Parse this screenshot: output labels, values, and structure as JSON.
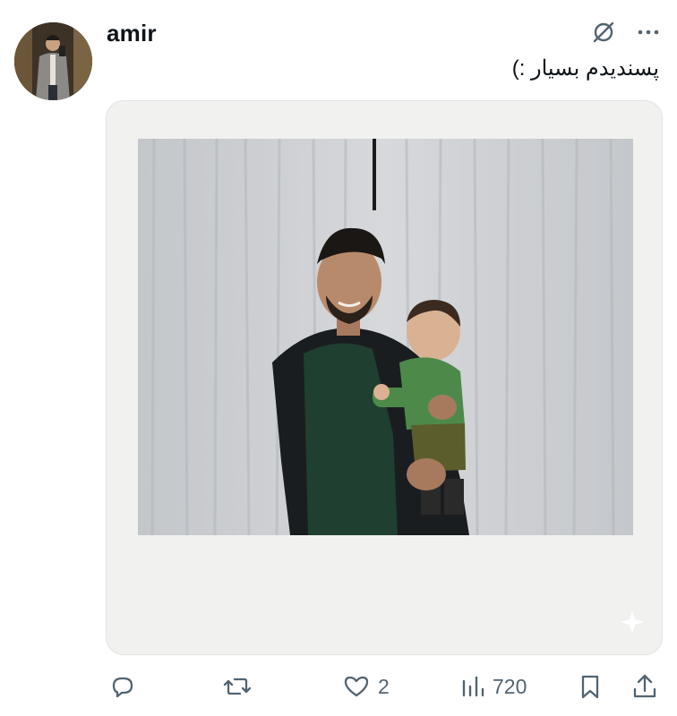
{
  "post": {
    "username": "amir",
    "text": "پسندیدم بسیار :)"
  },
  "icons": {
    "avatar": "profile-photo",
    "grok": "grok-icon",
    "more": "more-icon",
    "reply": "reply-icon",
    "repost": "repost-icon",
    "like": "heart-icon",
    "views": "views-icon",
    "bookmark": "bookmark-icon",
    "share": "share-icon",
    "sparkle": "sparkle-icon"
  },
  "actions": {
    "likes": "2",
    "views": "720"
  },
  "colors": {
    "text": "#0f1419",
    "muted": "#536471",
    "frame": "#f1f1ef"
  }
}
